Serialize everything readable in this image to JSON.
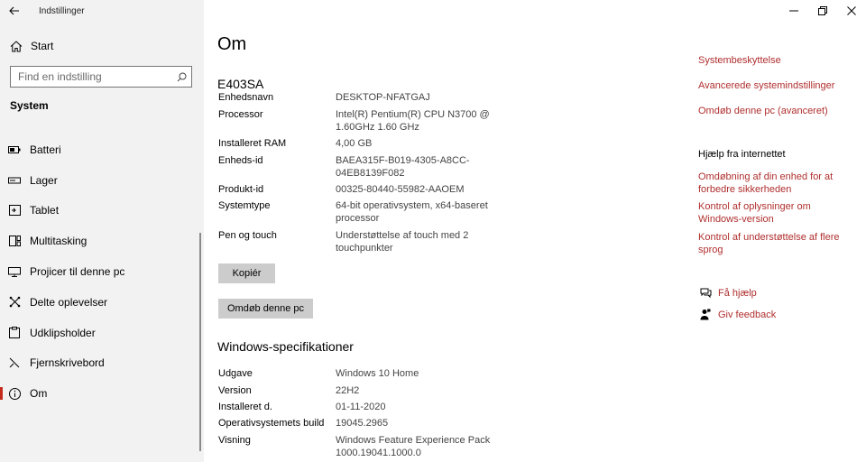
{
  "app": {
    "title": "Indstillinger"
  },
  "sidebar": {
    "home_label": "Start",
    "search_placeholder": "Find en indstilling",
    "group_title": "System",
    "items": [
      {
        "label": "Batteri",
        "icon": "battery-icon"
      },
      {
        "label": "Lager",
        "icon": "storage-icon"
      },
      {
        "label": "Tablet",
        "icon": "tablet-icon"
      },
      {
        "label": "Multitasking",
        "icon": "multitasking-icon"
      },
      {
        "label": "Projicer til denne pc",
        "icon": "project-icon"
      },
      {
        "label": "Delte oplevelser",
        "icon": "shared-experiences-icon"
      },
      {
        "label": "Udklipsholder",
        "icon": "clipboard-icon"
      },
      {
        "label": "Fjernskrivebord",
        "icon": "remote-desktop-icon"
      },
      {
        "label": "Om",
        "icon": "info-icon",
        "active": true
      }
    ]
  },
  "main": {
    "title": "Om",
    "device": {
      "name": "E403SA",
      "specs": [
        {
          "key": "Enhedsnavn",
          "value": "DESKTOP-NFATGAJ"
        },
        {
          "key": "Processor",
          "value": "Intel(R) Pentium(R) CPU  N3700  @ 1.60GHz   1.60 GHz"
        },
        {
          "key": "Installeret RAM",
          "value": "4,00 GB"
        },
        {
          "key": "Enheds-id",
          "value": "BAEA315F-B019-4305-A8CC-04EB8139F082"
        },
        {
          "key": "Produkt-id",
          "value": "00325-80440-55982-AAOEM"
        },
        {
          "key": "Systemtype",
          "value": "64-bit operativsystem, x64-baseret processor"
        },
        {
          "key": "Pen og touch",
          "value": "Understøttelse af touch med 2 touchpunkter"
        }
      ]
    },
    "copy_button": "Kopiér",
    "rename_button": "Omdøb denne pc",
    "windows_specs": {
      "title": "Windows-specifikationer",
      "specs": [
        {
          "key": "Udgave",
          "value": "Windows 10 Home"
        },
        {
          "key": "Version",
          "value": "22H2"
        },
        {
          "key": "Installeret d.",
          "value": "01-11-2020"
        },
        {
          "key": "Operativsystemets build",
          "value": "19045.2965"
        },
        {
          "key": "Visning",
          "value": "Windows Feature Experience Pack 1000.19041.1000.0"
        }
      ]
    }
  },
  "rail": {
    "links_top": [
      "Systembeskyttelse",
      "Avancerede systemindstillinger",
      "Omdøb denne pc (avanceret)"
    ],
    "help_title": "Hjælp fra internettet",
    "help_links": [
      "Omdøbning af din enhed for at forbedre sikkerheden",
      "Kontrol af oplysninger om Windows-version",
      "Kontrol af understøttelse af flere sprog"
    ],
    "get_help": "Få hjælp",
    "give_feedback": "Giv feedback"
  },
  "colors": {
    "accent": "#c42b1c",
    "link": "#b02e2e",
    "sidebar_bg": "#f2f2f2",
    "button_bg": "#cccccc"
  }
}
